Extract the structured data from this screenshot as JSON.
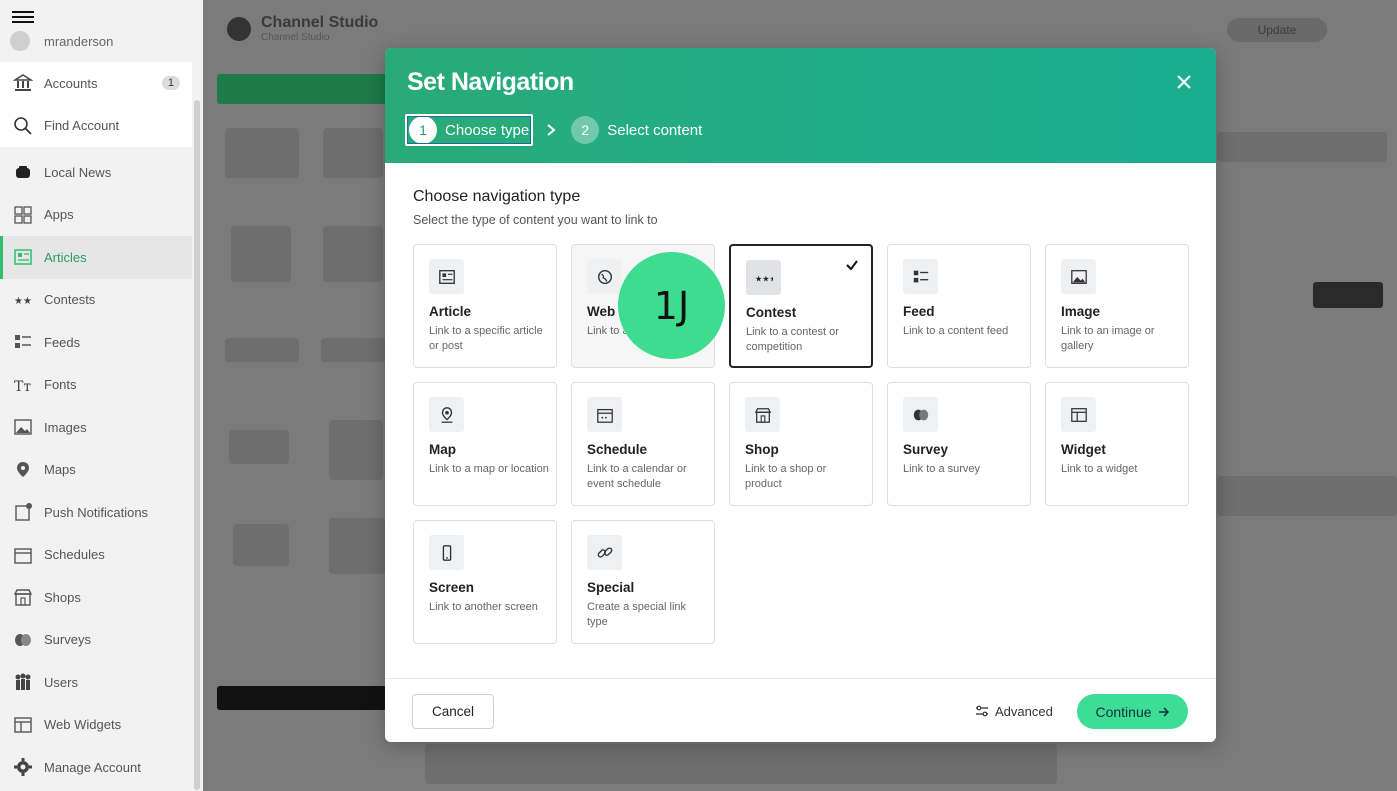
{
  "sidebar": {
    "username": "mranderson",
    "top_items": [
      {
        "label": "Accounts",
        "badge": "1"
      },
      {
        "label": "Find Account"
      }
    ],
    "items": [
      {
        "label": "Local News"
      },
      {
        "label": "Apps"
      },
      {
        "label": "Articles"
      },
      {
        "label": "Contests"
      },
      {
        "label": "Feeds"
      },
      {
        "label": "Fonts"
      },
      {
        "label": "Images"
      },
      {
        "label": "Maps"
      },
      {
        "label": "Push Notifications"
      },
      {
        "label": "Schedules"
      },
      {
        "label": "Shops"
      },
      {
        "label": "Surveys"
      },
      {
        "label": "Users"
      },
      {
        "label": "Web Widgets"
      },
      {
        "label": "Manage Account"
      }
    ]
  },
  "background": {
    "app_title": "Channel Studio",
    "app_subtitle": "Channel Studio",
    "update_label": "Update"
  },
  "modal": {
    "title": "Set Navigation",
    "steps": [
      {
        "num": "1",
        "label": "Choose type"
      },
      {
        "num": "2",
        "label": "Select content"
      }
    ],
    "section_title": "Choose navigation type",
    "section_subtitle": "Select the type of content you want to link to",
    "cards": [
      {
        "name": "Article",
        "desc": "Link to a specific article or post",
        "icon": "article-icon"
      },
      {
        "name": "Web",
        "desc": "Link to a website",
        "icon": "globe-icon"
      },
      {
        "name": "Contest",
        "desc": "Link to a contest or competition",
        "icon": "contest-icon",
        "selected": true
      },
      {
        "name": "Feed",
        "desc": "Link to a content feed",
        "icon": "feed-icon"
      },
      {
        "name": "Image",
        "desc": "Link to an image or gallery",
        "icon": "image-icon"
      },
      {
        "name": "Map",
        "desc": "Link to a map or location",
        "icon": "map-pin-icon"
      },
      {
        "name": "Schedule",
        "desc": "Link to a calendar or event schedule",
        "icon": "calendar-icon"
      },
      {
        "name": "Shop",
        "desc": "Link to a shop or product",
        "icon": "shop-icon"
      },
      {
        "name": "Survey",
        "desc": "Link to a survey",
        "icon": "survey-icon"
      },
      {
        "name": "Widget",
        "desc": "Link to a widget",
        "icon": "widget-icon"
      },
      {
        "name": "Screen",
        "desc": "Link to another screen",
        "icon": "phone-icon"
      },
      {
        "name": "Special",
        "desc": "Create a special link type",
        "icon": "link-icon"
      }
    ],
    "cancel_label": "Cancel",
    "advanced_label": "Advanced",
    "continue_label": "Continue"
  },
  "overlay_badge": "1J",
  "colors": {
    "header_green": "#2aaa78",
    "accent": "#3ddc97",
    "badge_green": "#3ddc8e"
  }
}
